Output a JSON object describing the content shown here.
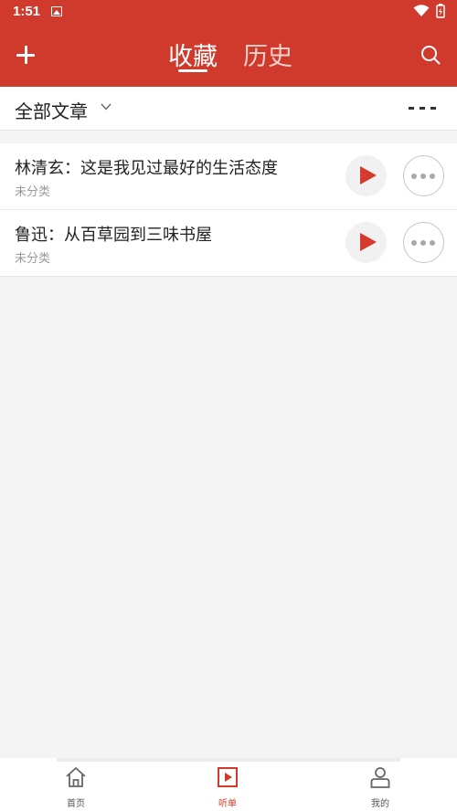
{
  "status_bar": {
    "time": "1:51"
  },
  "header": {
    "tabs": [
      {
        "label": "收藏",
        "active": true
      },
      {
        "label": "历史",
        "active": false
      }
    ],
    "accent_color": "#cf3a2c"
  },
  "filter": {
    "label": "全部文章"
  },
  "articles": [
    {
      "title": "林清玄：这是我见过最好的生活态度",
      "category": "未分类"
    },
    {
      "title": "鲁迅：从百草园到三味书屋",
      "category": "未分类"
    }
  ],
  "bottom_nav": [
    {
      "label": "首页",
      "icon": "home-icon",
      "active": false
    },
    {
      "label": "听单",
      "icon": "playlist-icon",
      "active": true
    },
    {
      "label": "我的",
      "icon": "profile-icon",
      "active": false
    }
  ]
}
